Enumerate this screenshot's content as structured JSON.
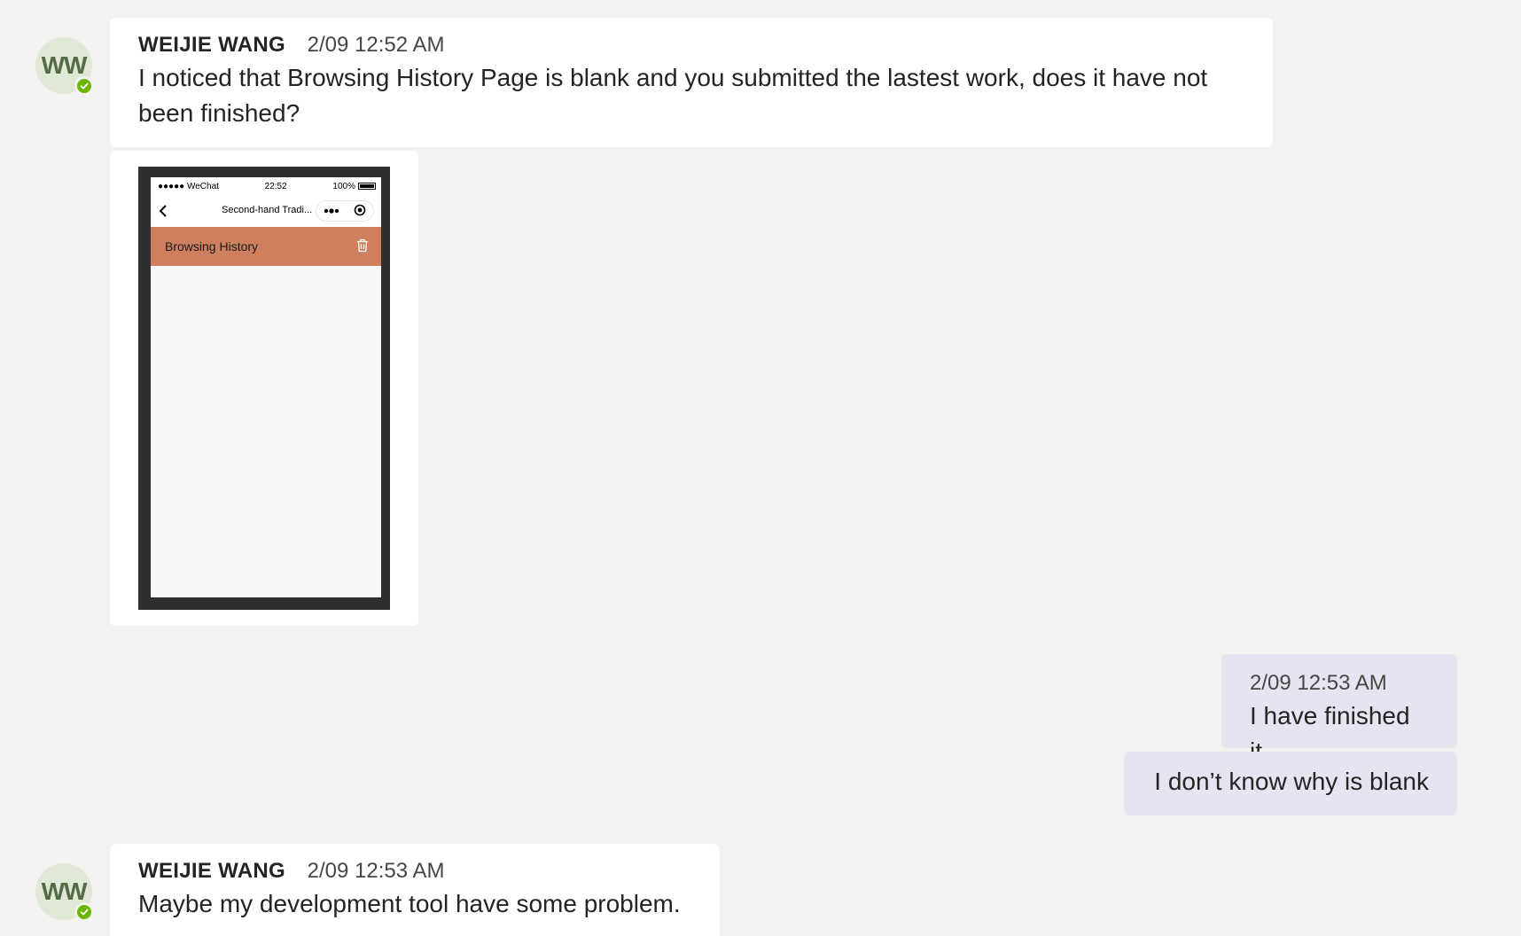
{
  "messages": [
    {
      "avatar_initials": "WW",
      "sender": "WEIJIE WANG",
      "timestamp": "2/09 12:52 AM",
      "text": "I noticed that Browsing History Page is blank and you submitted the lastest work, does it have not been finished?"
    },
    {
      "avatar_initials": "WW",
      "sender": "WEIJIE WANG",
      "timestamp": "2/09 12:53 AM",
      "text": "Maybe my development tool have some problem."
    }
  ],
  "my_messages": {
    "timestamp": "2/09 12:53 AM",
    "first": "I have finished it",
    "second": "I don’t know why is blank"
  },
  "attachment": {
    "status_signal": "●●●●● WeChat",
    "status_time": "22:52",
    "status_battery": "100%",
    "nav_title": "Second-hand Tradi...",
    "page_title": "Browsing History"
  },
  "colors": {
    "background": "#f3f2f1",
    "incoming_bubble": "#ffffff",
    "outgoing_bubble": "#e5e5f1",
    "presence": "#6bb700",
    "history_bar": "#cf7f5e"
  }
}
